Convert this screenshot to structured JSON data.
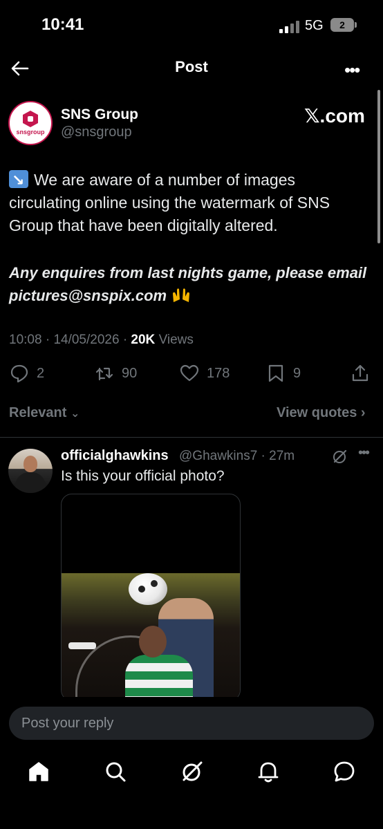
{
  "status_bar": {
    "time": "10:41",
    "network": "5G",
    "battery": "2"
  },
  "header": {
    "title": "Post",
    "back_icon": "arrow-left-icon",
    "more_icon": "ellipsis-icon"
  },
  "post": {
    "author_name": "SNS Group",
    "author_handle": "@snsgroup",
    "avatar_logo_text": "snsgroup",
    "watermark": "𝕏.com",
    "text_line": "We are aware of a number of images circulating online using the watermark of SNS Group that have been digitally altered.",
    "text_emphasis": "Any enquires from last nights game, please email pictures@snspix.com",
    "time": "10:08",
    "date": "14/05/2026",
    "views_count": "20K",
    "views_label": "Views",
    "separator": "·",
    "actions": {
      "replies": "2",
      "reposts": "90",
      "likes": "178",
      "bookmarks": "9"
    }
  },
  "filters": {
    "sort_label": "Relevant",
    "view_quotes_label": "View quotes"
  },
  "reply": {
    "name": "officialghawkins",
    "handle_time": "@Ghawkins7 · 27m",
    "text": "Is this your official photo?"
  },
  "composer": {
    "placeholder": "Post your reply"
  },
  "colors": {
    "background": "#000000",
    "text": "#e7e9ea",
    "muted": "#71767b",
    "brand": "#c4164e"
  }
}
